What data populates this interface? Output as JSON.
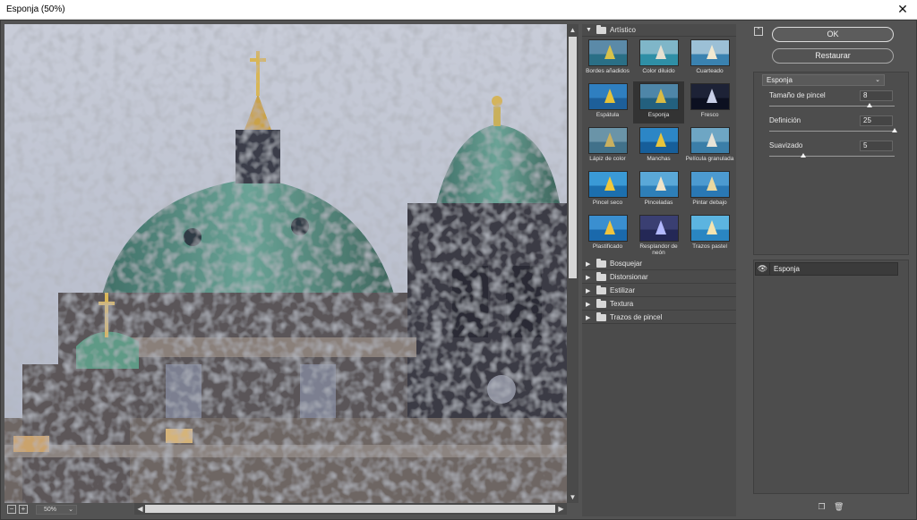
{
  "window": {
    "title": "Esponja (50%)",
    "close_glyph": "✕"
  },
  "preview": {
    "zoom": "50%"
  },
  "gallery": {
    "open_category": "Artístico",
    "thumbnails": [
      {
        "label": "Bordes añadidos",
        "icon": "thumb-bordes-anadidos"
      },
      {
        "label": "Color diluido",
        "icon": "thumb-color-diluido"
      },
      {
        "label": "Cuarteado",
        "icon": "thumb-cuarteado"
      },
      {
        "label": "Espátula",
        "icon": "thumb-espatula"
      },
      {
        "label": "Esponja",
        "icon": "thumb-esponja",
        "selected": true
      },
      {
        "label": "Fresco",
        "icon": "thumb-fresco"
      },
      {
        "label": "Lápiz de color",
        "icon": "thumb-lapiz-de-color"
      },
      {
        "label": "Manchas",
        "icon": "thumb-manchas"
      },
      {
        "label": "Película granulada",
        "icon": "thumb-pelicula-granulada"
      },
      {
        "label": "Pincel seco",
        "icon": "thumb-pincel-seco"
      },
      {
        "label": "Pinceladas",
        "icon": "thumb-pinceladas"
      },
      {
        "label": "Pintar debajo",
        "icon": "thumb-pintar-debajo"
      },
      {
        "label": "Plastificado",
        "icon": "thumb-plastificado"
      },
      {
        "label": "Resplandor de neón",
        "icon": "thumb-resplandor-de-neon"
      },
      {
        "label": "Trazos pastel",
        "icon": "thumb-trazos-pastel"
      }
    ],
    "closed_categories": [
      "Bosquejar",
      "Distorsionar",
      "Estilizar",
      "Textura",
      "Trazos de pincel"
    ]
  },
  "buttons": {
    "ok": "OK",
    "reset": "Restaurar"
  },
  "settings": {
    "filter": "Esponja",
    "params": [
      {
        "label": "Tamaño de pincel",
        "value": "8",
        "fraction": 0.8
      },
      {
        "label": "Definición",
        "value": "25",
        "fraction": 1.0
      },
      {
        "label": "Suavizado",
        "value": "5",
        "fraction": 0.27
      }
    ]
  },
  "layers": {
    "items": [
      {
        "name": "Esponja",
        "visible": true
      }
    ]
  },
  "colors": {
    "panel": "#535353",
    "gallery": "#4b4b4b",
    "dome": "#5f9384"
  }
}
